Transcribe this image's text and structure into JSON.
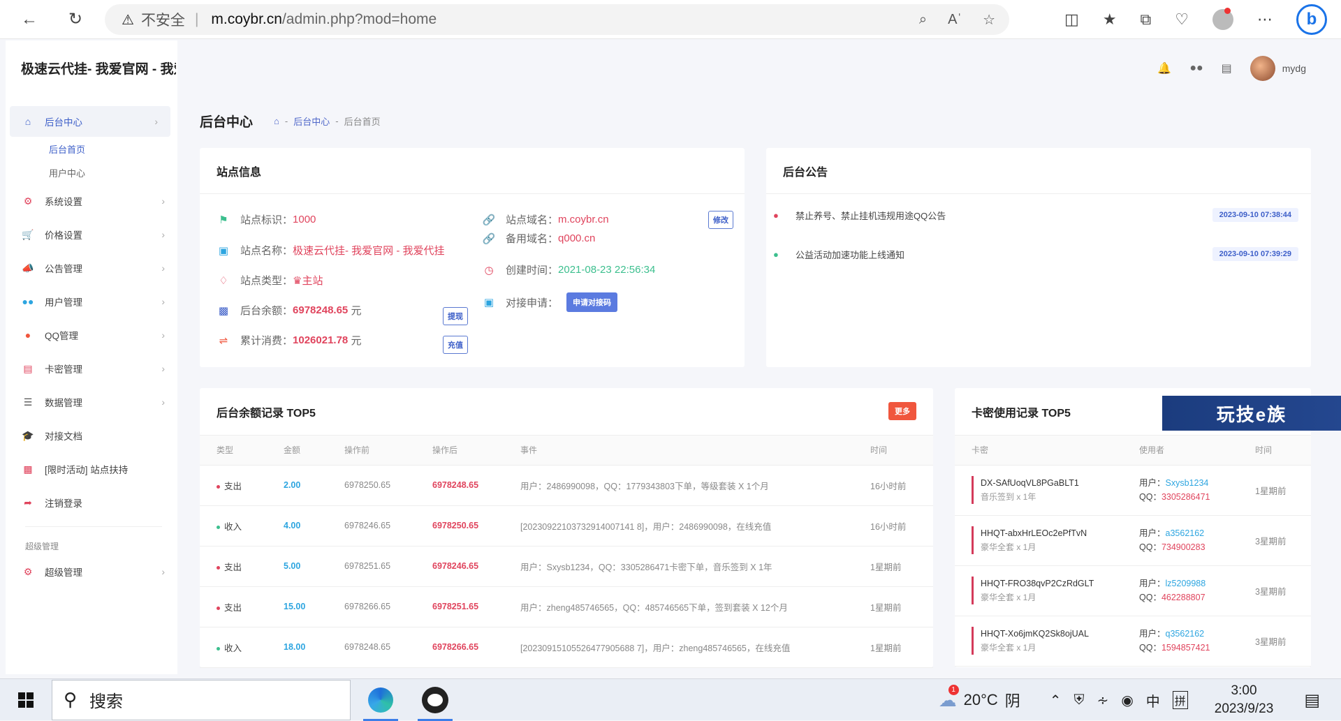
{
  "browser": {
    "insecure_label": "不安全",
    "url_host": "m.coybr.cn",
    "url_path": "/admin.php?mod=home"
  },
  "site": {
    "brand": "极速云代挂- 我爱官网 - 我爱代挂",
    "username": "mydg"
  },
  "sidebar": {
    "items": [
      {
        "label": "后台中心",
        "icon": "home-icon",
        "color": "#3c5ec8"
      },
      {
        "label": "系统设置",
        "icon": "gear-icon",
        "color": "#e0445d"
      },
      {
        "label": "价格设置",
        "icon": "cart-icon",
        "color": "#3cbf8e"
      },
      {
        "label": "公告管理",
        "icon": "megaphone-icon",
        "color": "#3c5ec8"
      },
      {
        "label": "用户管理",
        "icon": "users-icon",
        "color": "#2da5e0"
      },
      {
        "label": "QQ管理",
        "icon": "penguin-icon",
        "color": "#f0563d"
      },
      {
        "label": "卡密管理",
        "icon": "card-icon",
        "color": "#e0445d"
      },
      {
        "label": "数据管理",
        "icon": "list-icon",
        "color": "#555"
      },
      {
        "label": "对接文档",
        "icon": "graduation-icon",
        "color": "#e0445d"
      },
      {
        "label": "[限时活动] 站点扶持",
        "icon": "chart-icon",
        "color": "#e0445d"
      },
      {
        "label": "注销登录",
        "icon": "logout-icon",
        "color": "#e0445d"
      }
    ],
    "sub_items": [
      "后台首页",
      "用户中心"
    ],
    "section_header": "超级管理",
    "super_item": "超级管理"
  },
  "page": {
    "title": "后台中心",
    "crumbs": [
      "后台中心",
      "后台首页"
    ]
  },
  "site_info": {
    "title": "站点信息",
    "id_label": "站点标识：",
    "id_value": "1000",
    "name_label": "站点名称：",
    "name_value": "极速云代挂- 我爱官网 - 我爱代挂",
    "type_label": "站点类型：",
    "type_value": "主站",
    "balance_label": "后台余额：",
    "balance_value": "6978248.65",
    "balance_unit": "元",
    "spent_label": "累计消费：",
    "spent_value": "1026021.78",
    "spent_unit": "元",
    "domain_label": "站点域名：",
    "domain_value": "m.coybr.cn",
    "backup_label": "备用域名：",
    "backup_value": "q000.cn",
    "created_label": "创建时间：",
    "created_value": "2021-08-23 22:56:34",
    "api_label": "对接申请：",
    "api_button": "申请对接码",
    "edit_button": "修改",
    "withdraw_button": "提现",
    "recharge_button": "充值"
  },
  "notices": {
    "title": "后台公告",
    "items": [
      {
        "text": "禁止养号、禁止挂机违规用途QQ公告",
        "date": "2023-09-10 07:38:44"
      },
      {
        "text": "公益活动加速功能上线通知",
        "date": "2023-09-10 07:39:29"
      }
    ]
  },
  "balance_log": {
    "title": "后台余额记录 TOP5",
    "more": "更多",
    "headers": [
      "类型",
      "金额",
      "操作前",
      "操作后",
      "事件",
      "时间"
    ],
    "rows": [
      {
        "type": "支出",
        "amount": "2.00",
        "before": "6978250.65",
        "after": "6978248.65",
        "event": "用户：2486990098，QQ：1779343803下单，等级套装 X 1个月",
        "time": "16小时前"
      },
      {
        "type": "收入",
        "amount": "4.00",
        "before": "6978246.65",
        "after": "6978250.65",
        "event": "[20230922103732914007141 8]，用户：2486990098，在线充值",
        "time": "16小时前"
      },
      {
        "type": "支出",
        "amount": "5.00",
        "before": "6978251.65",
        "after": "6978246.65",
        "event": "用户：Sxysb1234，QQ：3305286471卡密下单，音乐签到 X 1年",
        "time": "1星期前"
      },
      {
        "type": "支出",
        "amount": "15.00",
        "before": "6978266.65",
        "after": "6978251.65",
        "event": "用户：zheng485746565，QQ：485746565下单，签到套装 X 12个月",
        "time": "1星期前"
      },
      {
        "type": "收入",
        "amount": "18.00",
        "before": "6978248.65",
        "after": "6978266.65",
        "event": "[20230915105526477905688 7]，用户：zheng485746565，在线充值",
        "time": "1星期前"
      }
    ]
  },
  "card_log": {
    "title": "卡密使用记录 TOP5",
    "headers": [
      "卡密",
      "使用者",
      "时间"
    ],
    "rows": [
      {
        "code": "DX-SAfUoqVL8PGaBLT1",
        "sub": "音乐签到 x 1年",
        "user_label": "用户：",
        "user": "Sxysb1234",
        "qq_label": "QQ：",
        "qq": "3305286471",
        "time": "1星期前"
      },
      {
        "code": "HHQT-abxHrLEOc2ePfTvN",
        "sub": "豪华全套 x 1月",
        "user_label": "用户：",
        "user": "a3562162",
        "qq_label": "QQ：",
        "qq": "734900283",
        "time": "3星期前"
      },
      {
        "code": "HHQT-FRO38qvP2CzRdGLT",
        "sub": "豪华全套 x 1月",
        "user_label": "用户：",
        "user": "lz5209988",
        "qq_label": "QQ：",
        "qq": "462288807",
        "time": "3星期前"
      },
      {
        "code": "HHQT-Xo6jmKQ2Sk8ojUAL",
        "sub": "豪华全套 x 1月",
        "user_label": "用户：",
        "user": "q3562162",
        "qq_label": "QQ：",
        "qq": "1594857421",
        "time": "3星期前"
      }
    ]
  },
  "watermark": "玩技e族",
  "taskbar": {
    "search_placeholder": "搜索",
    "weather_badge": "1",
    "temperature": "20°C",
    "weather": "阴",
    "ime1": "中",
    "ime2": "拼",
    "time": "3:00",
    "date": "2023/9/23"
  }
}
